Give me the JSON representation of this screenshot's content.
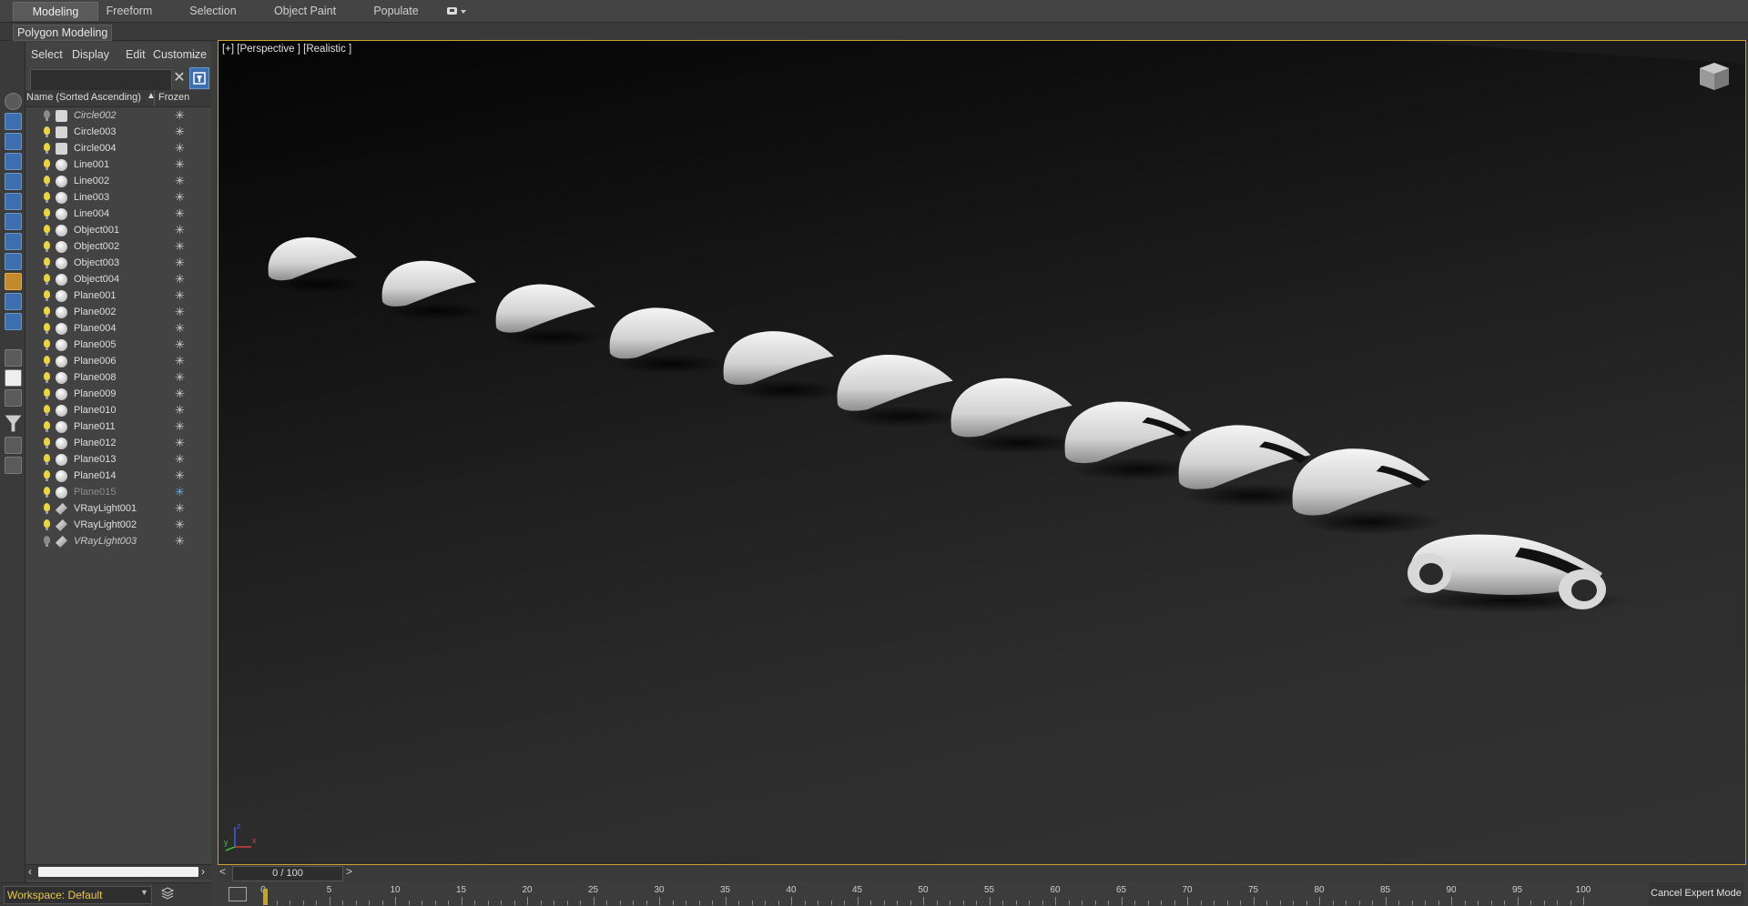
{
  "ribbon": {
    "tabs": [
      {
        "label": "Modeling",
        "active": true
      },
      {
        "label": "Freeform",
        "active": false
      },
      {
        "label": "Selection",
        "active": false
      },
      {
        "label": "Object Paint",
        "active": false
      },
      {
        "label": "Populate",
        "active": false
      }
    ],
    "extra_icon": "ribbon-options-icon",
    "subpanel_label": "Polygon Modeling"
  },
  "scene_explorer": {
    "menu": [
      "Select",
      "Display",
      "Edit",
      "Customize"
    ],
    "search": {
      "value": "",
      "placeholder": ""
    },
    "columns": {
      "name": "Name (Sorted Ascending)",
      "sort_arrow": "▲",
      "frozen": "Frozen"
    },
    "frozen_symbol": "✳",
    "objects": [
      {
        "name": "Circle002",
        "type": "shape",
        "visible": false,
        "hidden_style": true
      },
      {
        "name": "Circle003",
        "type": "shape",
        "visible": true
      },
      {
        "name": "Circle004",
        "type": "shape",
        "visible": true
      },
      {
        "name": "Line001",
        "type": "geometry",
        "visible": true
      },
      {
        "name": "Line002",
        "type": "geometry",
        "visible": true
      },
      {
        "name": "Line003",
        "type": "geometry",
        "visible": true
      },
      {
        "name": "Line004",
        "type": "geometry",
        "visible": true
      },
      {
        "name": "Object001",
        "type": "geometry",
        "visible": true
      },
      {
        "name": "Object002",
        "type": "geometry",
        "visible": true
      },
      {
        "name": "Object003",
        "type": "geometry",
        "visible": true
      },
      {
        "name": "Object004",
        "type": "geometry",
        "visible": true
      },
      {
        "name": "Plane001",
        "type": "geometry",
        "visible": true
      },
      {
        "name": "Plane002",
        "type": "geometry",
        "visible": true
      },
      {
        "name": "Plane004",
        "type": "geometry",
        "visible": true
      },
      {
        "name": "Plane005",
        "type": "geometry",
        "visible": true
      },
      {
        "name": "Plane006",
        "type": "geometry",
        "visible": true
      },
      {
        "name": "Plane008",
        "type": "geometry",
        "visible": true
      },
      {
        "name": "Plane009",
        "type": "geometry",
        "visible": true
      },
      {
        "name": "Plane010",
        "type": "geometry",
        "visible": true
      },
      {
        "name": "Plane011",
        "type": "geometry",
        "visible": true
      },
      {
        "name": "Plane012",
        "type": "geometry",
        "visible": true
      },
      {
        "name": "Plane013",
        "type": "geometry",
        "visible": true
      },
      {
        "name": "Plane014",
        "type": "geometry",
        "visible": true
      },
      {
        "name": "Plane015",
        "type": "geometry",
        "visible": true,
        "dimmed": true,
        "frozen": true
      },
      {
        "name": "VRayLight001",
        "type": "light",
        "visible": true
      },
      {
        "name": "VRayLight002",
        "type": "light",
        "visible": true
      },
      {
        "name": "VRayLight003",
        "type": "light",
        "visible": false,
        "hidden_style": true
      }
    ]
  },
  "workspace": {
    "label": "Workspace: Default"
  },
  "viewport": {
    "label": "[+] [Perspective ] [Realistic ]",
    "border_color": "#c9a227"
  },
  "timeline": {
    "frame_display": "0 / 100",
    "prev": "<",
    "next": ">",
    "ruler_labels": [
      "0",
      "5",
      "10",
      "15",
      "20",
      "25",
      "30",
      "35",
      "40",
      "45",
      "50",
      "55",
      "60",
      "65",
      "70",
      "75",
      "80",
      "85",
      "90",
      "95",
      "100"
    ]
  },
  "status": {
    "cancel_expert_label": "Cancel Expert Mode"
  },
  "colors": {
    "workspace_text": "#e9c84a",
    "accent_blue": "#3d6fae",
    "light_bulb": "#e8d34a",
    "frozen_active": "#6aa8ff"
  }
}
